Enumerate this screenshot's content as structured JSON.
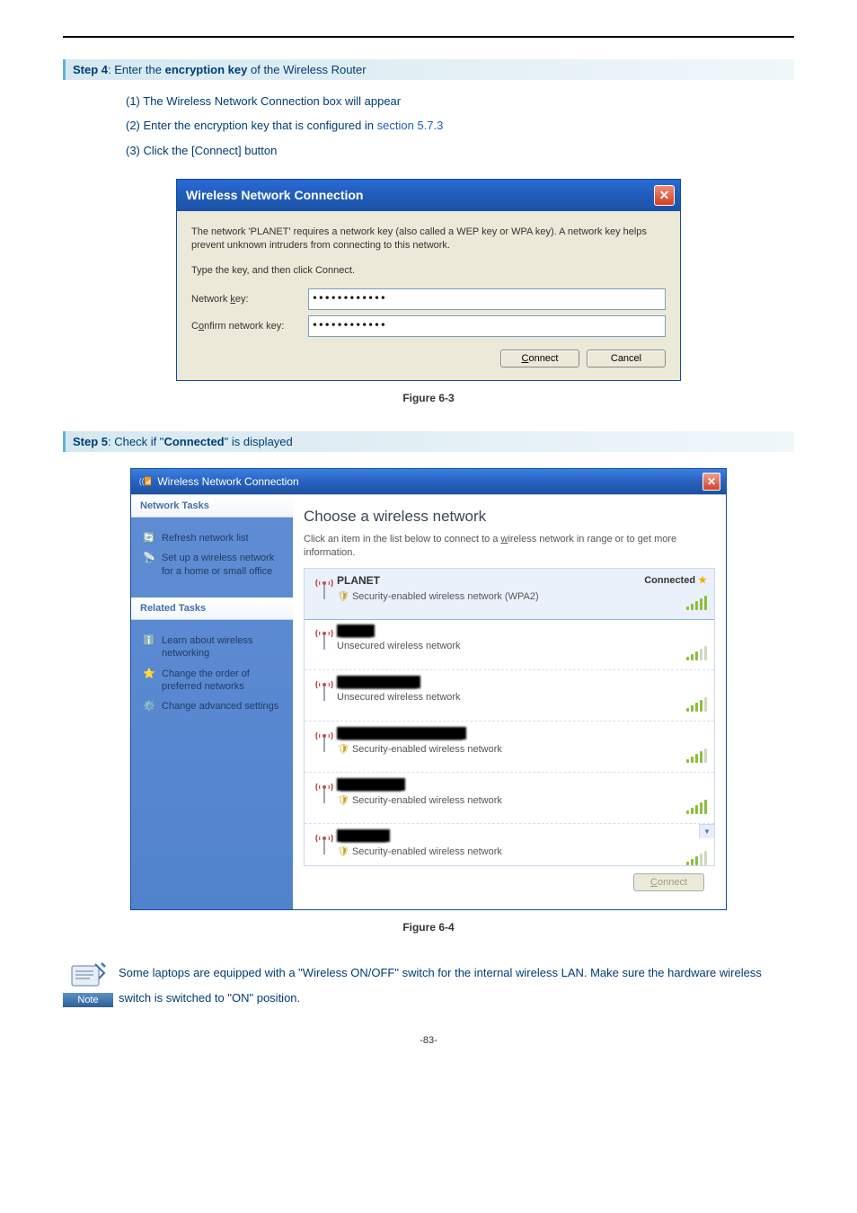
{
  "step4": {
    "prefix": "Step 4",
    "middle": ": Enter the ",
    "bold": "encryption key",
    "suffix": " of the Wireless Router",
    "items": {
      "i1_prefix": "(1)  The Wireless Network Connection box will appear",
      "i2_prefix": "(2)  Enter the encryption key that is configured in ",
      "i2_link": "section 5.7.3",
      "i3_prefix": "(3)  Click the [Connect] button"
    }
  },
  "dialog": {
    "title": "Wireless Network Connection",
    "desc": "The network 'PLANET' requires a network key (also called a WEP key or WPA key). A network key helps prevent unknown intruders from connecting to this network.",
    "type_prompt": "Type the key, and then click Connect.",
    "network_key_label": "Network key:",
    "confirm_key_label": "Confirm network key:",
    "network_key_value": "••••••••••••",
    "confirm_key_value": "••••••••••••",
    "connect": "Connect",
    "cancel": "Cancel"
  },
  "figure63": "Figure 6-3",
  "step5": {
    "prefix": "Step 5",
    "middle": ": Check if \"",
    "bold": "Connected",
    "suffix": "\" is displayed"
  },
  "wnc": {
    "title": "Wireless Network Connection",
    "sidebar": {
      "tasks_head": "Network Tasks",
      "related_head": "Related Tasks",
      "refresh": "Refresh network list",
      "setup": "Set up a wireless network for a home or small office",
      "learn": "Learn about wireless networking",
      "order": "Change the order of preferred networks",
      "advanced": "Change advanced settings"
    },
    "main_title": "Choose a wireless network",
    "main_inst": "Click an item in the list below to connect to a wireless network in range or to get more information.",
    "connected": "Connected",
    "connect_btn": "Connect",
    "networks": [
      {
        "name": "PLANET",
        "sec": "Security-enabled wireless network (WPA2)",
        "shield": true,
        "status": true,
        "signal": 5,
        "blur": false
      },
      {
        "name": "████",
        "sec": "Unsecured wireless network",
        "shield": false,
        "status": false,
        "signal": 3,
        "blur": true
      },
      {
        "name": "██████████",
        "sec": "Unsecured wireless network",
        "shield": false,
        "status": false,
        "signal": 4,
        "blur": true
      },
      {
        "name": "████████████████",
        "sec": "Security-enabled wireless network",
        "shield": true,
        "status": false,
        "signal": 4,
        "blur": true
      },
      {
        "name": "████████",
        "sec": "Security-enabled wireless network",
        "shield": true,
        "status": false,
        "signal": 5,
        "blur": true
      },
      {
        "name": "██████",
        "sec": "Security-enabled wireless network",
        "shield": true,
        "status": false,
        "signal": 3,
        "blur": true
      }
    ]
  },
  "figure64": "Figure 6-4",
  "note": {
    "label": "Note",
    "text": "Some laptops are equipped with a \"Wireless ON/OFF\" switch for the internal wireless LAN. Make sure the hardware wireless switch is switched to \"ON\" position."
  },
  "page_number": "-83-"
}
